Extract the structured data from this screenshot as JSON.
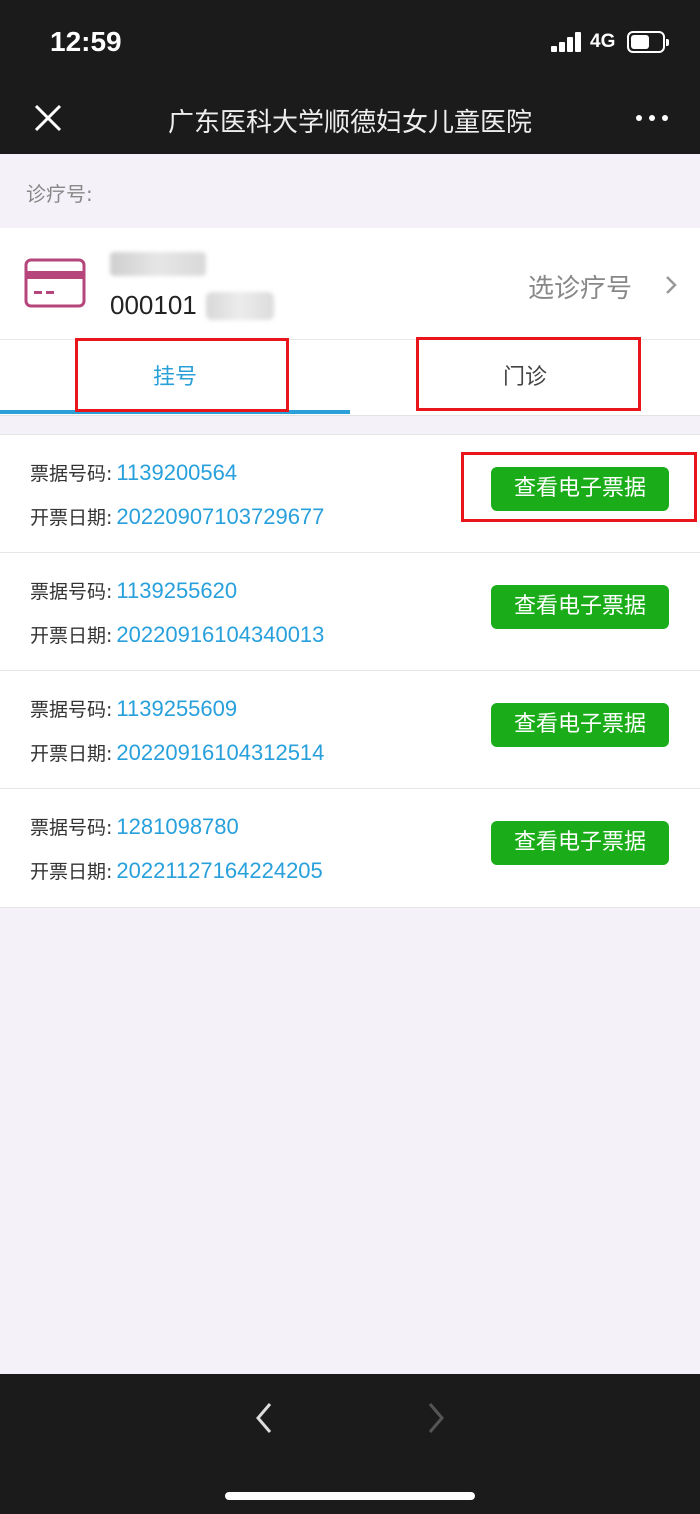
{
  "status_bar": {
    "time": "12:59",
    "network": "4G"
  },
  "nav": {
    "title": "广东医科大学顺德妇女儿童医院"
  },
  "patient": {
    "section_label": "诊疗号:",
    "card_number_visible": "000101",
    "select_label": "选诊疗号"
  },
  "tabs": [
    {
      "label": "挂号",
      "active": true
    },
    {
      "label": "门诊",
      "active": false
    }
  ],
  "labels": {
    "receipt_no": "票据号码:",
    "issue_date": "开票日期:"
  },
  "receipts": [
    {
      "number": "1139200564",
      "date": "20220907103729677",
      "button": "查看电子票据"
    },
    {
      "number": "1139255620",
      "date": "20220916104340013",
      "button": "查看电子票据"
    },
    {
      "number": "1139255609",
      "date": "20220916104312514",
      "button": "查看电子票据"
    },
    {
      "number": "1281098780",
      "date": "20221127164224205",
      "button": "查看电子票据"
    }
  ],
  "colors": {
    "accent_blue": "#2a9fd8",
    "button_green": "#1aad19",
    "highlight_red": "#e8151b",
    "card_icon": "#b5457a"
  }
}
